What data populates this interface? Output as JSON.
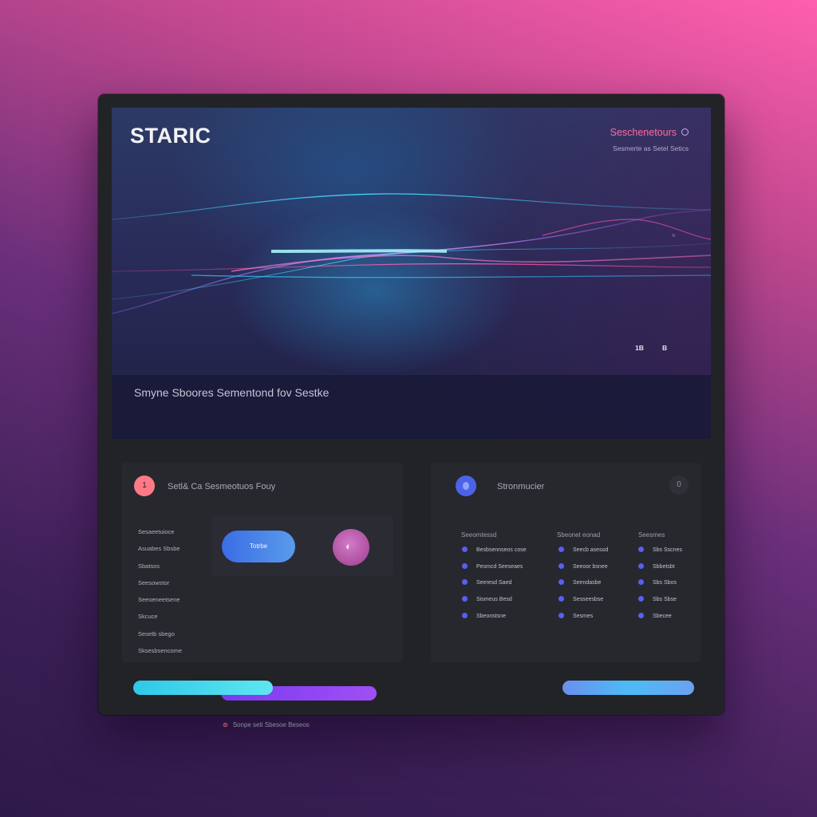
{
  "hero": {
    "brand": "STARIC",
    "top_right_title": "Seschenetours",
    "top_right_sub": "Sesmerte as Setel Setics",
    "mini_label": "ᵃᶦ",
    "controls": [
      "1B",
      "B"
    ],
    "caption": "Smyne Sboores  Sementond fov Sestke"
  },
  "left_panel": {
    "badge": "1",
    "title": "Setl& Ca Sesmeotuos Fouy",
    "list": [
      "Sesaeetuioce",
      "Asuabes Sbsbe",
      "Sbatsos",
      "Seesowstor",
      "Seeoeneetsene",
      "Skcuce",
      "Sesetb sbego",
      "Sksesbsencome"
    ],
    "pill_label": "Totrbe",
    "note": "Sonpe seti Sbesoe Beseos"
  },
  "right_panel": {
    "title": "Stronmucier",
    "button": "0",
    "columns": [
      {
        "heading": "Seeomtessd",
        "items": [
          "Besbsennseos cose",
          "Pesmcd Seeseaes",
          "Seeresd Saed",
          "Sismeus Besd",
          "Sbeonstsne"
        ]
      },
      {
        "heading": "Sbeonet eonad",
        "items": [
          "Seecb asesod",
          "Seeoor bsnee",
          "Seendasbe",
          "Sesseesbse",
          "Sesmes"
        ]
      },
      {
        "heading": "Seesmes",
        "items": [
          "Sbs Sscnes",
          "Sbbetsbt",
          "Sbs Sbos",
          "Sbs Sbse",
          "Sbecee"
        ]
      }
    ]
  },
  "colors": {
    "accent_pink": "#ff6aa0",
    "accent_purple": "#9a47f3",
    "accent_cyan": "#40d8ec",
    "accent_blue": "#4c63e8"
  }
}
